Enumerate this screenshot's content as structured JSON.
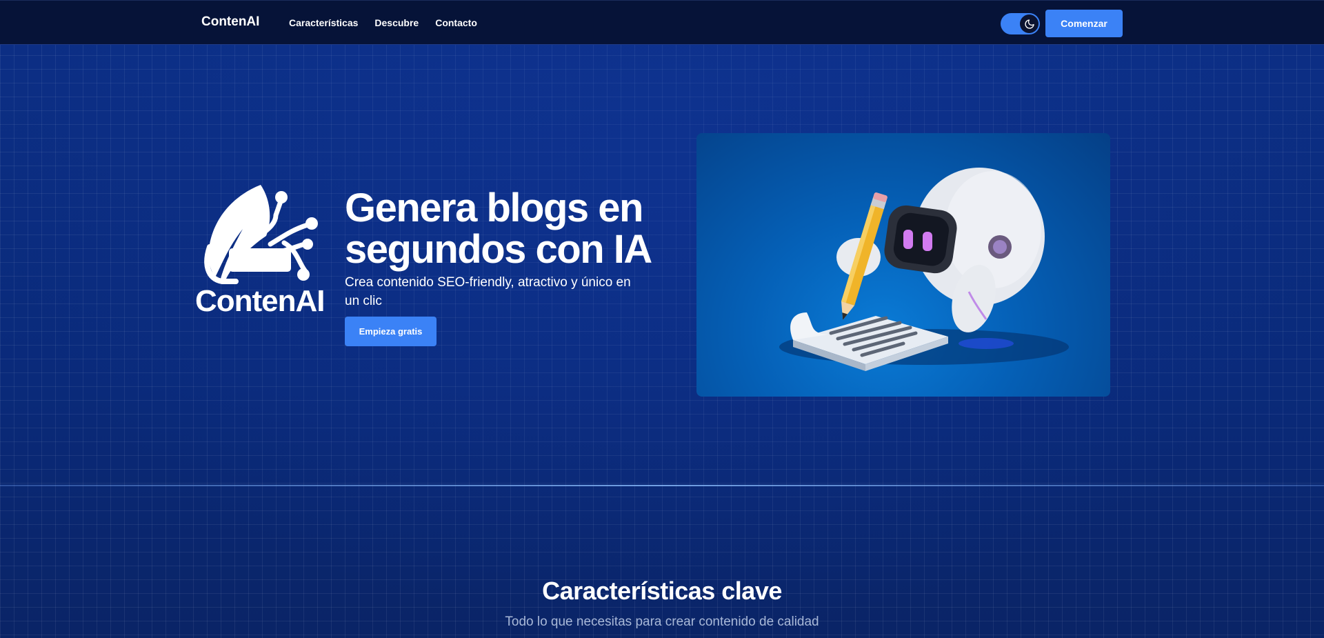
{
  "nav": {
    "brand": "ContenAI",
    "links": [
      "Características",
      "Descubre",
      "Contacto"
    ],
    "cta_label": "Comenzar"
  },
  "hero": {
    "logo_text": "ContenAI",
    "title": "Genera blogs en segundos con IA",
    "subtitle": "Crea contenido SEO-friendly, atractivo y único en un clic",
    "button_label": "Empieza gratis"
  },
  "features": {
    "title": "Características clave",
    "subtitle": "Todo lo que necesitas para crear contenido de calidad"
  },
  "icons": {
    "theme": "moon-icon",
    "logo": "quill-circuit-icon",
    "illustration": "robot-writing-illustration"
  },
  "colors": {
    "accent": "#3b82f6",
    "navbar": "#061338",
    "background": "#0b2b7d"
  }
}
